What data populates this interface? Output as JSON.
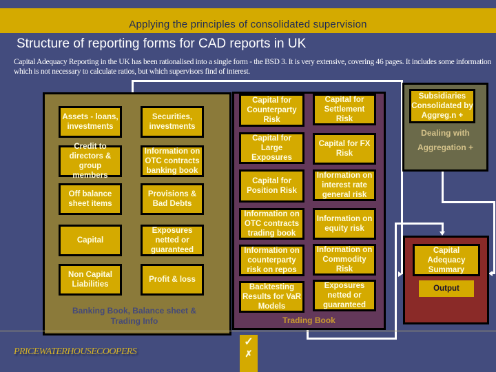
{
  "header": {
    "banner": "Applying the principles of consolidated supervision",
    "title": "Structure of reporting forms for CAD reports in UK",
    "intro": "Capital Adequacy Reporting in the UK has been rationalised into a single form - the BSD 3.  It is very extensive, covering 46 pages.  It includes some information which is not necessary to calculate ratios, but which supervisors find of interest."
  },
  "banking_book": {
    "caption": "Banking Book, Balance sheet & Trading Info",
    "items": [
      "Assets - loans, investments",
      "Securities, investments",
      "Credit to directors & group members",
      "Information on OTC contracts banking book",
      "Off balance sheet items",
      "Provisions & Bad Debts",
      "Capital",
      "Exposures netted or guaranteed",
      "Non Capital Liabilities",
      "Profit & loss"
    ]
  },
  "trading_book": {
    "caption": "Trading Book",
    "items": [
      "Capital for Counterparty Risk",
      "Capital for Settlement Risk",
      "Capital for Large Exposures",
      "Capital for FX Risk",
      "Capital for Position  Risk",
      "Information on interest rate general risk",
      "Information on OTC contracts trading book",
      "Information on equity risk",
      "Information on counterparty risk on repos",
      "Information on Commodity Risk",
      "Backtesting Results for VaR Models",
      "Exposures netted or guaranteed"
    ]
  },
  "subsidiaries": {
    "box": "Subsidiaries Consolidated by Aggreg.n +",
    "caption_line1": "Dealing with",
    "caption_line2": "Aggregation +"
  },
  "summary": {
    "box": "Capital Adequacy Summary",
    "output": "Output"
  },
  "footer": {
    "logo": "PRICEWATERHOUSECOOPERS",
    "check": "✓",
    "cross": "✗"
  },
  "colors": {
    "background": "#434c7e",
    "accent_yellow": "#d4aa00",
    "banking_panel": "#8b7a3a",
    "trading_panel": "#63385a",
    "subsidiaries_panel": "#6b6a4a",
    "summary_panel": "#8a2a28"
  }
}
